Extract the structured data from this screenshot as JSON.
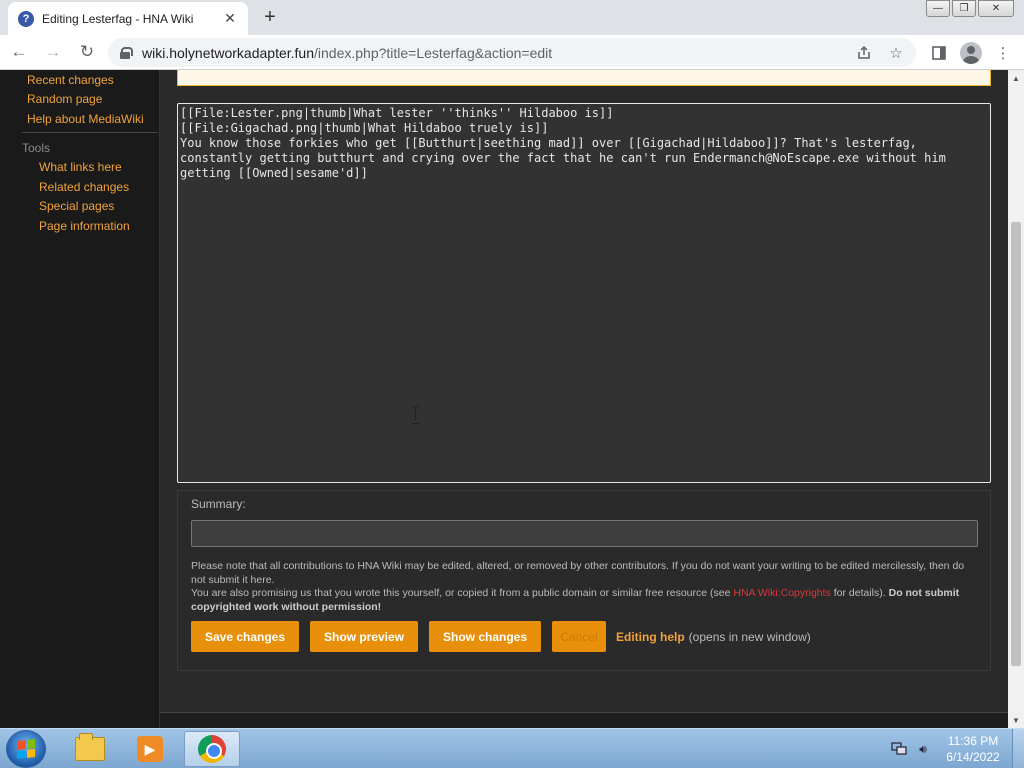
{
  "browser": {
    "tab": {
      "title": "Editing Lesterfag - HNA Wiki",
      "favicon": "?",
      "close": "✕"
    },
    "new_tab": "+",
    "window": {
      "minimize": "—",
      "maximize": "❐",
      "close": "✕"
    },
    "nav": {
      "back": "←",
      "forward": "→",
      "reload": "↻"
    },
    "address": {
      "host": "wiki.holynetworkadapter.fun",
      "path": "/index.php?title=Lesterfag&action=edit"
    }
  },
  "sidebar": {
    "navigation": [
      {
        "label": "Recent changes"
      },
      {
        "label": "Random page"
      },
      {
        "label": "Help about MediaWiki"
      }
    ],
    "tools_heading": "Tools",
    "tools": [
      {
        "label": "What links here"
      },
      {
        "label": "Related changes"
      },
      {
        "label": "Special pages"
      },
      {
        "label": "Page information"
      }
    ]
  },
  "editor": {
    "text": "[[File:Lester.png|thumb|What lester ''thinks'' Hildaboo is]]\n[[File:Gigachad.png|thumb|What Hildaboo truely is]]\nYou know those forkies who get [[Butthurt|seething mad]] over [[Gigachad|Hildaboo]]? That's lesterfag, constantly getting butthurt and crying over the fact that he can't run Endermanch@NoEscape.exe without him getting [[Owned|sesame'd]]"
  },
  "summary": {
    "label": "Summary:",
    "value": ""
  },
  "legal": {
    "line1": "Please note that all contributions to HNA Wiki may be edited, altered, or removed by other contributors. If you do not want your writing to be edited mercilessly, then do not submit it here.",
    "line2_pre": "You are also promising us that you wrote this yourself, or copied it from a public domain or similar free resource (see ",
    "line2_link": "HNA Wiki:Copyrights",
    "line2_post": " for details). ",
    "line2_bold": "Do not submit copyrighted work without permission!"
  },
  "buttons": {
    "save": "Save changes",
    "preview": "Show preview",
    "changes": "Show changes",
    "cancel": "Cancel",
    "help_link": "Editing help",
    "help_note": "(opens in new window)"
  },
  "taskbar": {
    "clock_time": "11:36 PM",
    "clock_date": "6/14/2022"
  },
  "colors": {
    "accent": "#e8900c",
    "link": "#f0a23c",
    "red_link": "#d9383a",
    "editor_bg": "#323232",
    "page_bg": "#2a2a2a"
  }
}
